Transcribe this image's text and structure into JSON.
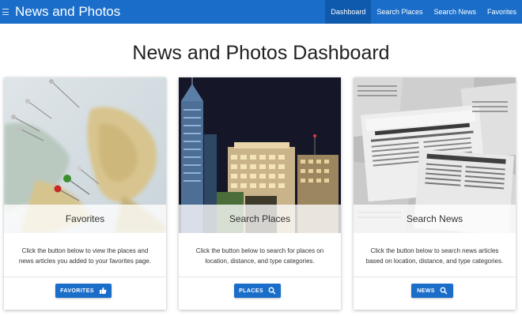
{
  "navbar": {
    "brand": "News and Photos",
    "links": [
      {
        "label": "Dashboard",
        "active": true
      },
      {
        "label": "Search Places",
        "active": false
      },
      {
        "label": "Search News",
        "active": false
      },
      {
        "label": "Favorites",
        "active": false
      }
    ]
  },
  "page_title": "News and Photos Dashboard",
  "cards": [
    {
      "title": "Favorites",
      "text": "Click the button below to view the places and news articles you added to your favorites page.",
      "button_label": "FAVORITES",
      "button_icon": "thumbs-up-icon",
      "image": "map-with-pins"
    },
    {
      "title": "Search Places",
      "text": "Click the button below to search for places on location, distance, and type categories.",
      "button_label": "PLACES",
      "button_icon": "search-icon",
      "image": "city-skyline-at-night"
    },
    {
      "title": "Search News",
      "text": "Click the button below to search news articles based on location, distance, and type categories.",
      "button_label": "NEWS",
      "button_icon": "search-icon",
      "image": "newspapers"
    }
  ],
  "colors": {
    "primary": "#1a6ec9",
    "primary_dark": "#0f5aad",
    "heading": "#212121"
  }
}
